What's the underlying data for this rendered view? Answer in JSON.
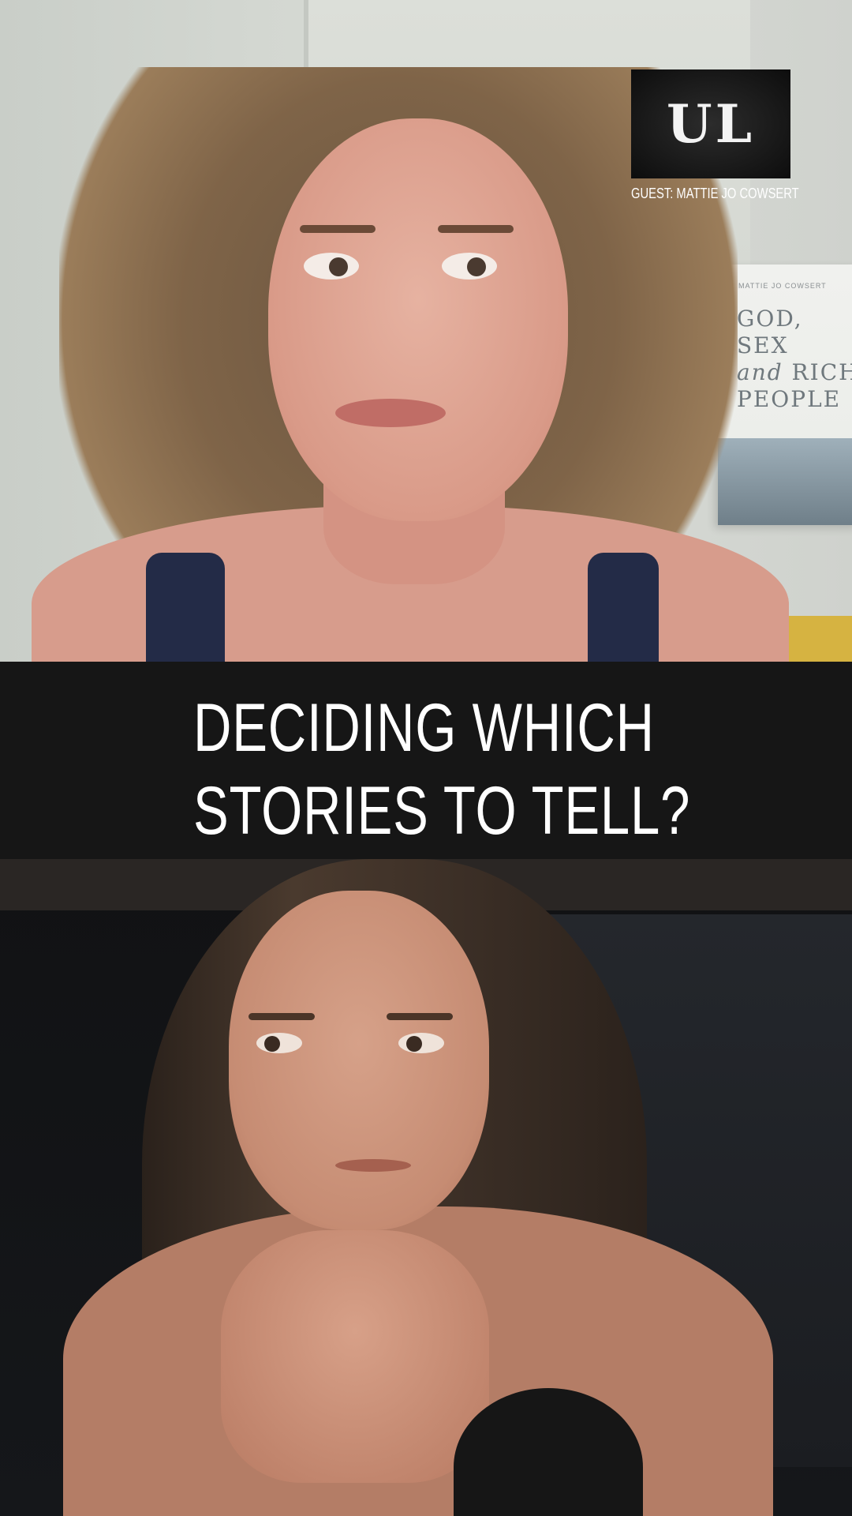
{
  "logo": {
    "text": "UL"
  },
  "guest_caption": "GUEST: MATTIE JO COWSERT",
  "caption": {
    "line1": "DECIDING WHICH",
    "line2": "STORIES TO TELL?"
  },
  "background_props": {
    "mug_text": "GOD, SE\nRICH P",
    "book_title_lines": [
      "GOD, SEX",
      "and RICH",
      "PEOPLE"
    ]
  }
}
